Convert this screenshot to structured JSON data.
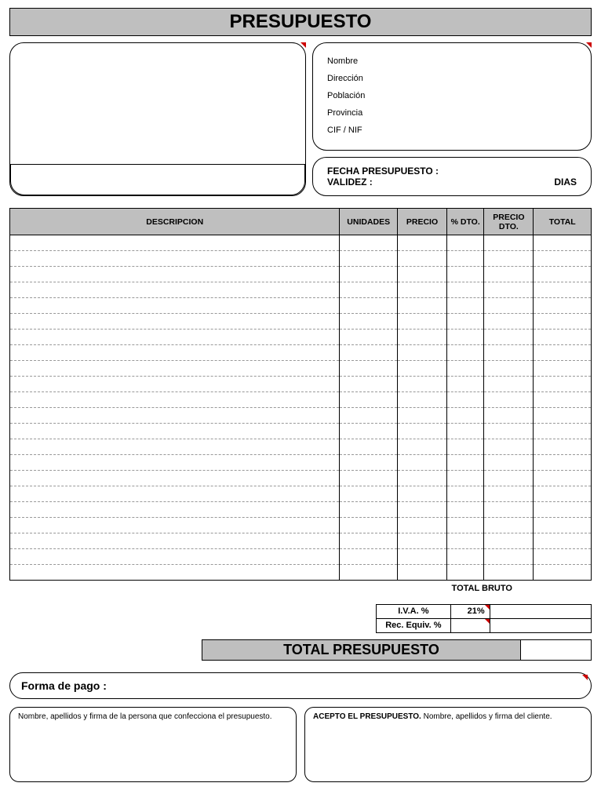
{
  "title": "PRESUPUESTO",
  "client": {
    "nombre_label": "Nombre",
    "direccion_label": "Dirección",
    "poblacion_label": "Población",
    "provincia_label": "Provincia",
    "cif_label": "CIF / NIF"
  },
  "date": {
    "fecha_label": "FECHA PRESUPUESTO :",
    "validez_label": "VALIDEZ :",
    "validez_unit": "DIAS"
  },
  "columns": {
    "descripcion": "DESCRIPCION",
    "unidades": "UNIDADES",
    "precio": "PRECIO",
    "pct_dto": "% DTO.",
    "precio_dto": "PRECIO DTO.",
    "total": "TOTAL"
  },
  "footer": {
    "total_bruto": "TOTAL BRUTO",
    "iva_label": "I.V.A. %",
    "iva_pct": "21%",
    "rec_equiv_label": "Rec. Equiv. %",
    "total_presupuesto": "TOTAL PRESUPUESTO"
  },
  "pago_label": "Forma de pago :",
  "sign": {
    "preparer": "Nombre, apellidos y firma de la persona que confecciona el presupuesto.",
    "accept_bold": "ACEPTO EL PRESUPUESTO.",
    "accept_rest": " Nombre, apellidos y firma del cliente."
  },
  "row_count": 22
}
